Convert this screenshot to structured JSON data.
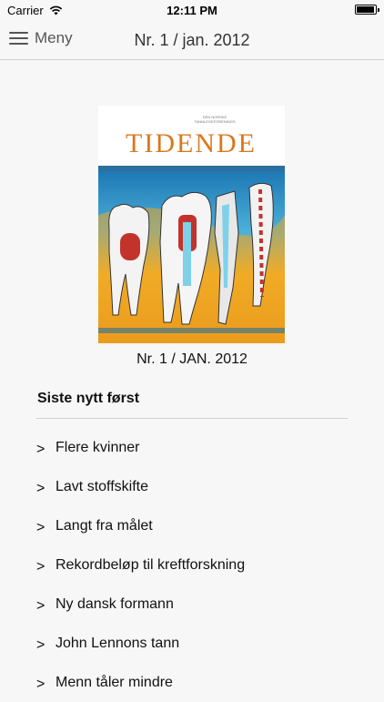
{
  "status_bar": {
    "carrier": "Carrier",
    "time": "12:11 PM",
    "battery_level": 0.95
  },
  "nav": {
    "menu_label": "Meny",
    "title": "Nr. 1 / jan. 2012",
    "menu_icon": "hamburger-icon"
  },
  "cover": {
    "publisher_line1": "DEN NORSKE",
    "publisher_line2": "TANNLEGEFORENINGS",
    "masthead": "TIDENDE",
    "caption": "Nr. 1 / JAN. 2012",
    "colors": {
      "masthead": "#d9781e",
      "bg_top": "#1a73b0",
      "bg_bottom": "#e9a41e"
    }
  },
  "list": {
    "heading": "Siste nytt først",
    "chevron_glyph": ">",
    "items": [
      {
        "label": "Flere kvinner"
      },
      {
        "label": "Lavt stoffskifte"
      },
      {
        "label": "Langt fra målet"
      },
      {
        "label": "Rekordbeløp til kreftforskning"
      },
      {
        "label": "Ny dansk formann"
      },
      {
        "label": "John Lennons tann"
      },
      {
        "label": "Menn tåler mindre"
      }
    ]
  }
}
